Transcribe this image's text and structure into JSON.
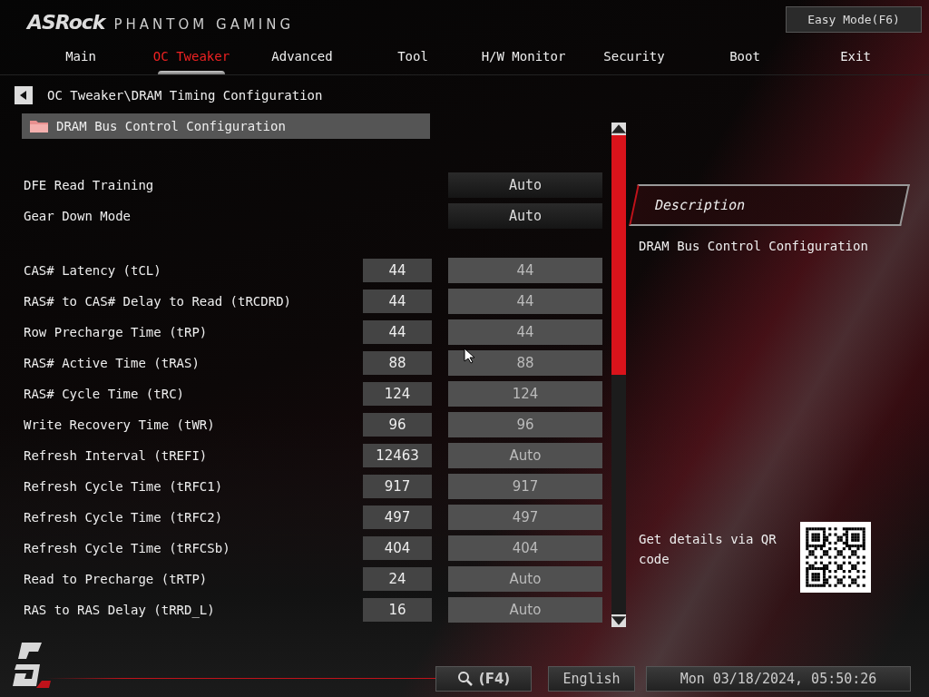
{
  "brand": {
    "name": "ASRock",
    "subtitle": "PHANTOM GAMING"
  },
  "easy_mode_button": "Easy Mode(F6)",
  "tabs": [
    {
      "label": "Main",
      "selected": false
    },
    {
      "label": "OC Tweaker",
      "selected": true
    },
    {
      "label": "Advanced",
      "selected": false
    },
    {
      "label": "Tool",
      "selected": false
    },
    {
      "label": "H/W Monitor",
      "selected": false
    },
    {
      "label": "Security",
      "selected": false
    },
    {
      "label": "Boot",
      "selected": false
    },
    {
      "label": "Exit",
      "selected": false
    }
  ],
  "breadcrumb": "OC Tweaker\\DRAM Timing Configuration",
  "section": {
    "label": "DRAM Bus Control Configuration",
    "selected": true
  },
  "settings": [
    {
      "kind": "option",
      "label": "DFE Read Training",
      "setting": "Auto"
    },
    {
      "kind": "option",
      "label": "Gear Down Mode",
      "setting": "Auto"
    },
    {
      "kind": "spacer"
    },
    {
      "kind": "value",
      "label": "CAS# Latency (tCL)",
      "current": "44",
      "setting": "44"
    },
    {
      "kind": "value",
      "label": "RAS# to CAS# Delay to Read  (tRCDRD)",
      "current": "44",
      "setting": "44"
    },
    {
      "kind": "value",
      "label": "Row Precharge Time (tRP)",
      "current": "44",
      "setting": "44"
    },
    {
      "kind": "value",
      "label": "RAS# Active Time (tRAS)",
      "current": "88",
      "setting": "88"
    },
    {
      "kind": "value",
      "label": "RAS# Cycle Time (tRC)",
      "current": "124",
      "setting": "124"
    },
    {
      "kind": "value",
      "label": "Write Recovery Time (tWR)",
      "current": "96",
      "setting": "96"
    },
    {
      "kind": "value",
      "label": "Refresh Interval (tREFI)",
      "current": "12463",
      "setting": "Auto"
    },
    {
      "kind": "value",
      "label": "Refresh Cycle Time (tRFC1)",
      "current": "917",
      "setting": "917"
    },
    {
      "kind": "value",
      "label": "Refresh Cycle Time (tRFC2)",
      "current": "497",
      "setting": "497"
    },
    {
      "kind": "value",
      "label": "Refresh Cycle Time (tRFCSb)",
      "current": "404",
      "setting": "404"
    },
    {
      "kind": "value",
      "label": "Read to Precharge (tRTP)",
      "current": "24",
      "setting": "Auto"
    },
    {
      "kind": "value",
      "label": "RAS to RAS Delay (tRRD_L)",
      "current": "16",
      "setting": "Auto"
    }
  ],
  "description": {
    "title": "Description",
    "text": "DRAM Bus Control Configuration"
  },
  "qr_hint": "Get details via QR code",
  "status_bar": {
    "search_key": "(F4)",
    "language": "English",
    "datetime": "Mon 03/18/2024, 05:50:26"
  }
}
